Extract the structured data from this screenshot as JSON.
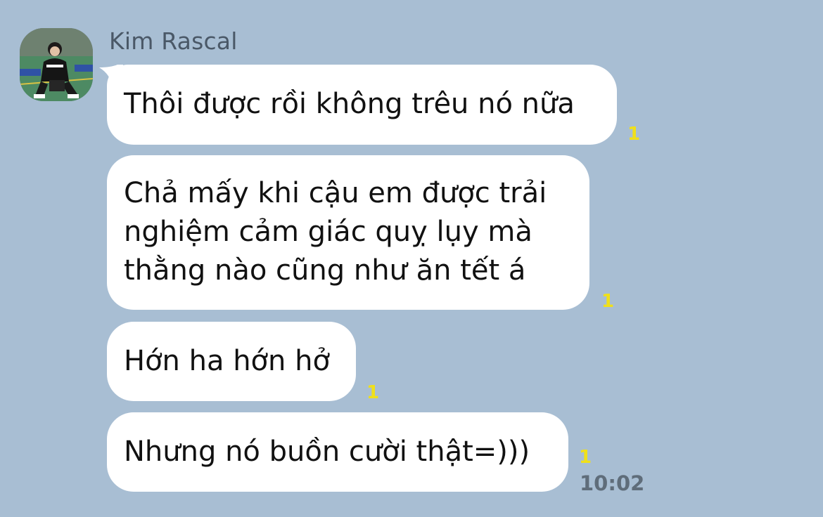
{
  "sender": {
    "name": "Kim Rascal",
    "avatar_icon": "profile-photo-icon"
  },
  "messages": [
    {
      "text": "Thôi được rồi không trêu nó nữa",
      "unread": "1"
    },
    {
      "text": "Chả mấy khi cậu em được trải\nnghiệm cảm giác quỵ lụy mà\nthằng nào cũng như ăn tết á",
      "unread": "1"
    },
    {
      "text": "Hớn ha hớn hở",
      "unread": "1"
    },
    {
      "text": "Nhưng nó buồn cười thật=)))",
      "unread": "1"
    }
  ],
  "last_timestamp": "10:02",
  "colors": {
    "background": "#a8bed3",
    "bubble": "#ffffff",
    "unread": "#f0e01a",
    "timestamp": "#5f6d7a",
    "name": "#4a5867"
  }
}
